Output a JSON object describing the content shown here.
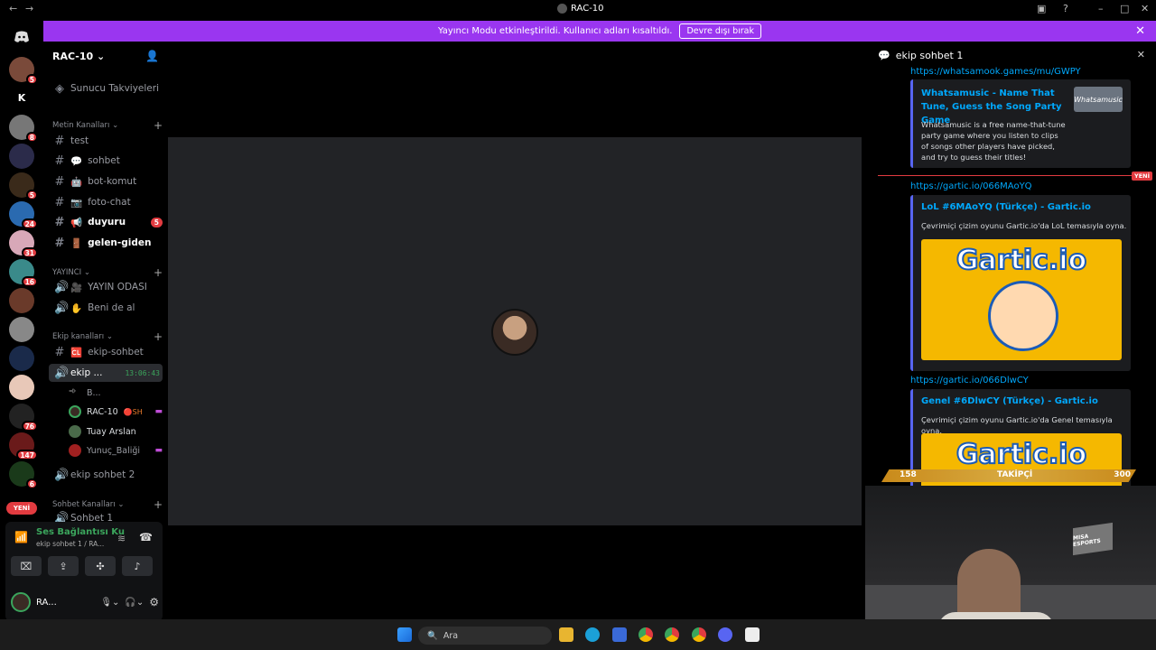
{
  "window": {
    "title": "RAC-10"
  },
  "banner": {
    "message": "Yayıncı Modu etkinleştirildi. Kullanıcı adları kısaltıldı.",
    "button": "Devre dışı bırak"
  },
  "servers": [
    {
      "letter": "",
      "badge": "5",
      "color": "#7a4a3a"
    },
    {
      "letter": "K",
      "badge": "",
      "color": "#000"
    },
    {
      "letter": "",
      "badge": "8",
      "color": "#777"
    },
    {
      "letter": "",
      "badge": "",
      "color": "#2b2b4a"
    },
    {
      "letter": "",
      "badge": "5",
      "color": "#3a2a1a"
    },
    {
      "letter": "",
      "badge": "24",
      "color": "#2a6ab0"
    },
    {
      "letter": "",
      "badge": "31",
      "color": "#d8a8b8"
    },
    {
      "letter": "",
      "badge": "16",
      "color": "#3a8a8a"
    },
    {
      "letter": "",
      "badge": "",
      "color": "#6a3a2a"
    },
    {
      "letter": "",
      "badge": "",
      "color": "#888"
    },
    {
      "letter": "",
      "badge": "",
      "color": "#1a2a4a"
    },
    {
      "letter": "",
      "badge": "",
      "color": "#e8c8b8"
    },
    {
      "letter": "",
      "badge": "76",
      "color": "#222"
    },
    {
      "letter": "",
      "badge": "147",
      "color": "#6a1a1a"
    },
    {
      "letter": "",
      "badge": "6",
      "color": "#1a3a1a"
    }
  ],
  "new_label": "YENİ",
  "sidebar": {
    "server_name": "RAC-10",
    "boosts": "Sunucu Takviyeleri",
    "categories": {
      "text": "Metin Kanalları",
      "streamer": "YAYINCI",
      "team": "Ekip kanalları",
      "chat": "Sohbet Kanalları"
    },
    "text_channels": [
      {
        "name": "test",
        "emoji": ""
      },
      {
        "name": "sohbet",
        "emoji": "💬"
      },
      {
        "name": "bot-komut",
        "emoji": "🤖"
      },
      {
        "name": "foto-chat",
        "emoji": "📷"
      },
      {
        "name": "duyuru",
        "emoji": "📢",
        "badge": "5"
      },
      {
        "name": "gelen-giden",
        "emoji": "🚪"
      }
    ],
    "streamer_channels": [
      {
        "name": "YAYIN ODASI",
        "emoji": "🎥"
      },
      {
        "name": "Beni de al",
        "emoji": "✋"
      }
    ],
    "team_text": {
      "name": "ekip-sohbet",
      "emoji": "🆑"
    },
    "active_voice": {
      "name": "ekip ...",
      "time": "13:06:43"
    },
    "voice_users": [
      {
        "name": "B...",
        "color": "#555"
      },
      {
        "name": "RAC-10",
        "color": "#3a2b24"
      },
      {
        "name": "Tuay Arslan",
        "color": "#4a6a4a"
      },
      {
        "name": "Yunuç_Baliği",
        "color": "#a02020"
      }
    ],
    "team_voice2": {
      "name": "ekip sohbet 2"
    },
    "chat_voice": {
      "name": "Sohbet 1"
    }
  },
  "voice_panel": {
    "status": "Ses Bağlantısı Ku",
    "sub": "ekip sohbet 1 / RA...",
    "username": "RA..."
  },
  "thread": {
    "title": "ekip sohbet 1",
    "link_top": "https://whatsamook.games/mu/GWPY",
    "embed1": {
      "title": "Whatsamusic - Name That Tune, Guess the Song Party Game",
      "desc": "Whatsamusic is a free name-that-tune party game where you listen to clips of songs other players have picked, and try to guess their titles!",
      "thumb": "Whatsamusic"
    },
    "new_tag": "YENİ",
    "link2": "https://gartic.io/066MAoYQ",
    "embed2": {
      "title": "LoL #6MAoYQ (Türkçe) - Gartic.io",
      "desc": "Çevrimiçi çizim oyunu Gartic.io'da LoL temasıyla oyna."
    },
    "link3": "https://gartic.io/066DlwCY",
    "embed3": {
      "title": "Genel #6DlwCY (Türkçe) - Gartic.io",
      "desc": "Çevrimiçi çizim oyunu Gartic.io'da Genel temasıyla oyna."
    },
    "gartic_logo": "Gartic.io"
  },
  "overlay": {
    "left": "158",
    "label": "TAKİPÇİ",
    "right": "300",
    "cam_logo": "MISA ESPORTS"
  },
  "taskbar": {
    "search": "Ara"
  }
}
